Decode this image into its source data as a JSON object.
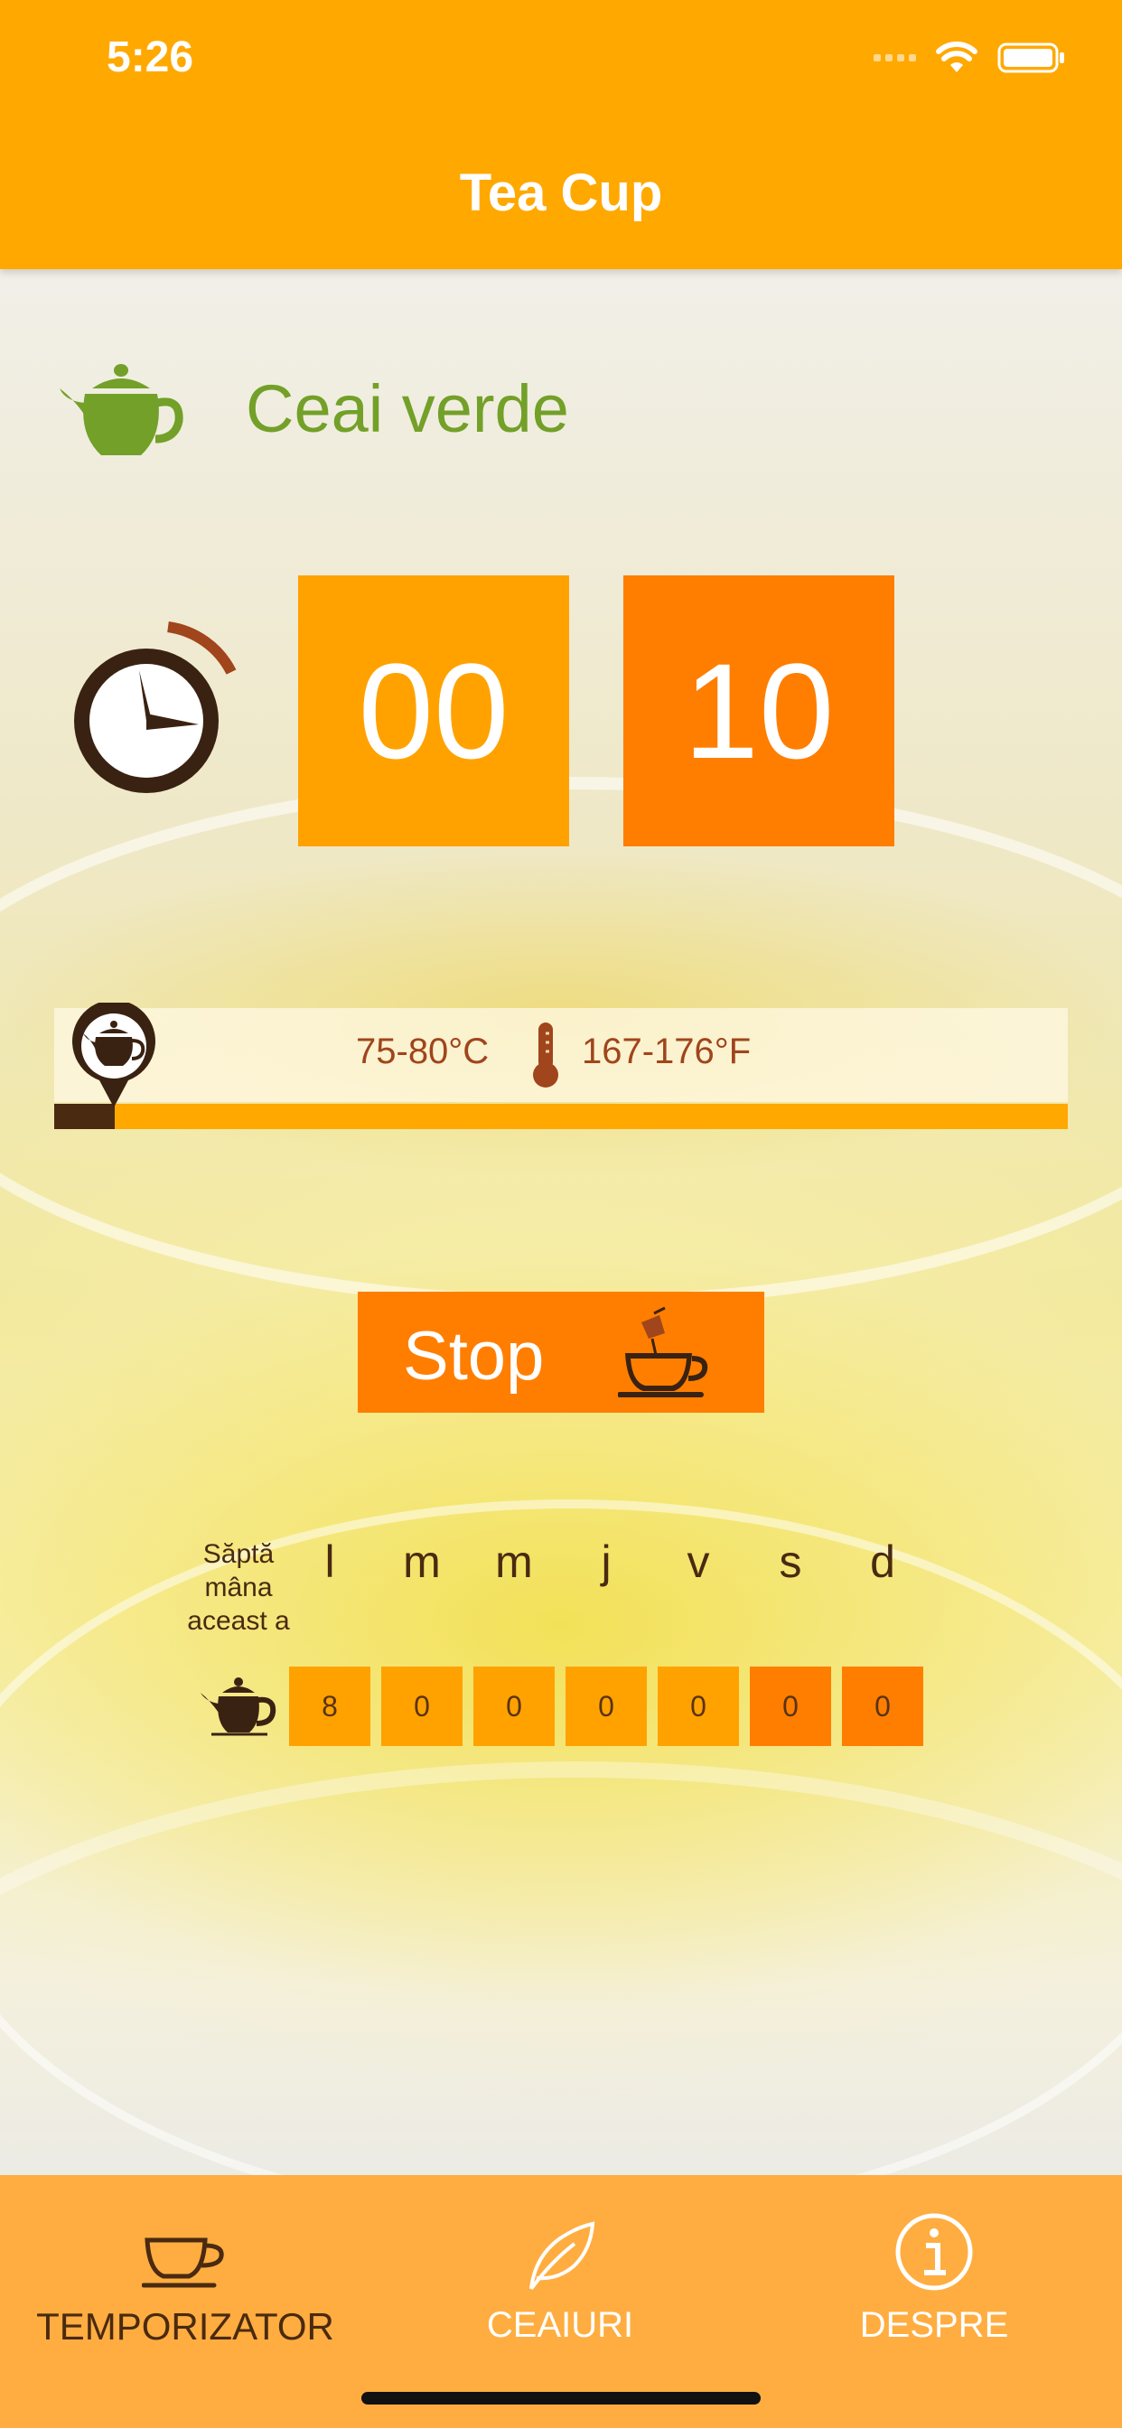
{
  "status_bar": {
    "time": "5:26"
  },
  "nav": {
    "title": "Tea Cup"
  },
  "tea": {
    "name": "Ceai verde"
  },
  "timer": {
    "minutes": "00",
    "seconds": "10"
  },
  "temperature": {
    "celsius": "75-80°C",
    "fahrenheit": "167-176°F",
    "progress": 0.06
  },
  "stop_button": {
    "label": "Stop"
  },
  "week": {
    "label": "Săptă mâna aceast a",
    "days": [
      "l",
      "m",
      "m",
      "j",
      "v",
      "s",
      "d"
    ],
    "counts": [
      "8",
      "0",
      "0",
      "0",
      "0",
      "0",
      "0"
    ]
  },
  "tabs": [
    {
      "label": "TEMPORIZATOR",
      "icon": "teacup-icon",
      "active": true
    },
    {
      "label": "CEAIURI",
      "icon": "leaf-icon",
      "active": false
    },
    {
      "label": "DESPRE",
      "icon": "info-icon",
      "active": false
    }
  ],
  "colors": {
    "bar": "#ffa800",
    "box_light": "#ffa200",
    "box_dark": "#ff7e00",
    "tea_green": "#73a028",
    "brown": "#4a2a10"
  }
}
